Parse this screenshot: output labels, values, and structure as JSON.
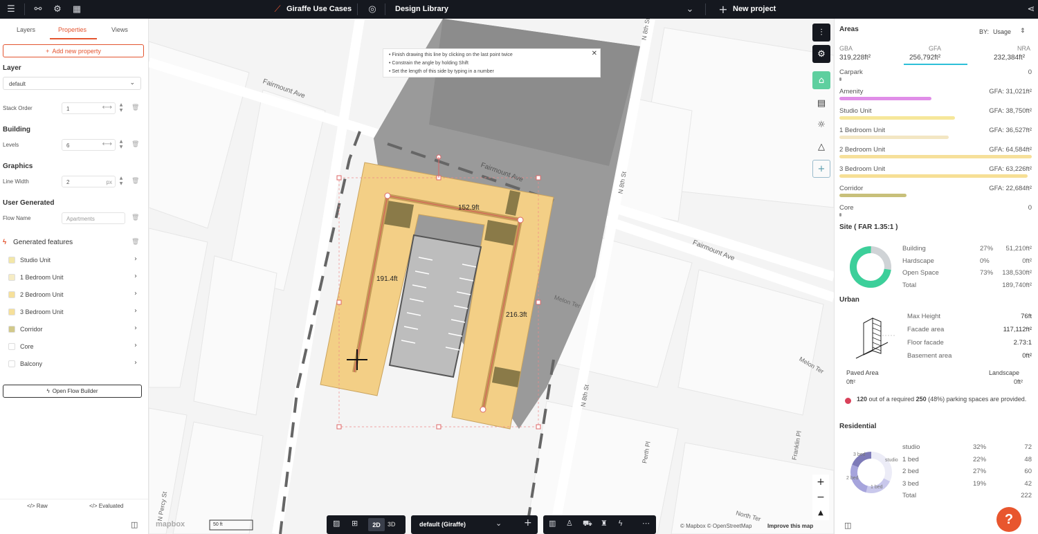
{
  "topbar": {
    "project_name": "Giraffe Use Cases",
    "library": "Design Library",
    "new_project": "New project"
  },
  "left_panel": {
    "tabs": [
      "Layers",
      "Properties",
      "Views"
    ],
    "add_property": "Add new property",
    "layer_heading": "Layer",
    "layer_value": "default",
    "stack_order_label": "Stack Order",
    "stack_order_value": "1",
    "building_heading": "Building",
    "levels_label": "Levels",
    "levels_value": "6",
    "graphics_heading": "Graphics",
    "line_width_label": "Line Width",
    "line_width_value": "2",
    "line_width_unit": "px",
    "user_generated_heading": "User Generated",
    "flow_name_label": "Flow Name",
    "flow_name_placeholder": "Apartments",
    "generated_heading": "Generated features",
    "features": [
      {
        "label": "Studio Unit",
        "color": "#f3e7a8"
      },
      {
        "label": "1 Bedroom Unit",
        "color": "#f6ecc4"
      },
      {
        "label": "2 Bedroom Unit",
        "color": "#f6e09a"
      },
      {
        "label": "3 Bedroom Unit",
        "color": "#f6e09a"
      },
      {
        "label": "Corridor",
        "color": "#d2c98a"
      },
      {
        "label": "Core",
        "color": "#ffffff"
      },
      {
        "label": "Balcony",
        "color": "#ffffff"
      }
    ],
    "open_flow_builder": "Open Flow Builder",
    "raw": "Raw",
    "evaluated": "Evaluated"
  },
  "map": {
    "hints": [
      "Finish drawing this line by clicking on the last point twice",
      "Constrain the angle by holding Shift",
      "Set the length of this side by typing in a number"
    ],
    "streets": [
      "Fairmount Ave",
      "Fairmount Ave",
      "Fairmount Ave",
      "N 8th St",
      "N 8th St",
      "N 8th St",
      "Melon Ter",
      "Melon Ter",
      "Perth Pl",
      "Franklin Pl",
      "North Ter",
      "N Percy St"
    ],
    "dimensions": [
      "152.9ft",
      "191.4ft",
      "216.3ft"
    ],
    "scale": "50 ft",
    "attribution": "© Mapbox © OpenStreetMap",
    "improve": "Improve this map",
    "mapbox_logo": "mapbox",
    "mode_2d": "2D",
    "mode_3d": "3D",
    "style_select": "default (Giraffe)"
  },
  "right_panel": {
    "areas_heading": "Areas",
    "by_label": "BY:",
    "by_value": "Usage",
    "gba_label": "GBA",
    "gba_value": "319,228ft²",
    "gfa_label": "GFA",
    "gfa_value": "256,792ft²",
    "nra_label": "NRA",
    "nra_value": "232,384ft²",
    "usages": [
      {
        "name": "Carpark",
        "value": "0",
        "color": "#999999",
        "fraction": 0.01
      },
      {
        "name": "Amenity",
        "value": "GFA: 31,021ft²",
        "color": "#e08ee8",
        "fraction": 0.48
      },
      {
        "name": "Studio Unit",
        "value": "GFA: 38,750ft²",
        "color": "#f6e79a",
        "fraction": 0.6
      },
      {
        "name": "1 Bedroom Unit",
        "value": "GFA: 36,527ft²",
        "color": "#f3e6c3",
        "fraction": 0.57
      },
      {
        "name": "2 Bedroom Unit",
        "value": "GFA: 64,584ft²",
        "color": "#f6e09a",
        "fraction": 1.0
      },
      {
        "name": "3 Bedroom Unit",
        "value": "GFA: 63,226ft²",
        "color": "#f6df95",
        "fraction": 0.98
      },
      {
        "name": "Corridor",
        "value": "GFA: 22,684ft²",
        "color": "#c8c07a",
        "fraction": 0.35
      },
      {
        "name": "Core",
        "value": "0",
        "color": "#999999",
        "fraction": 0.01
      }
    ],
    "site_heading": "Site ( FAR 1.35:1 )",
    "site_rows": [
      {
        "label": "Building",
        "pct": "27%",
        "value": "51,210ft²"
      },
      {
        "label": "Hardscape",
        "pct": "0%",
        "value": "0ft²"
      },
      {
        "label": "Open Space",
        "pct": "73%",
        "value": "138,530ft²"
      },
      {
        "label": "Total",
        "pct": "",
        "value": "189,740ft²"
      }
    ],
    "site_donut": {
      "building": 0.27,
      "open_space": 0.73,
      "building_color": "#cfd3d6",
      "open_color": "#3ccf9a"
    },
    "urban_heading": "Urban",
    "urban_rows": [
      {
        "label": "Max Height",
        "value": "76ft"
      },
      {
        "label": "Facade area",
        "value": "117,112ft²"
      },
      {
        "label": "Floor facade",
        "value": "2.73:1"
      },
      {
        "label": "Basement area",
        "value": "0ft²"
      }
    ],
    "paved_label": "Paved Area",
    "paved_value": "0ft²",
    "landscape_label": "Landscape",
    "landscape_value": "0ft²",
    "parking_count": "120",
    "parking_text_a": "out of a required",
    "parking_required": "250",
    "parking_text_b": "(48%) parking spaces are provided.",
    "residential_heading": "Residential",
    "residential_rows": [
      {
        "label": "studio",
        "pct": "32%",
        "value": "72"
      },
      {
        "label": "1 bed",
        "pct": "22%",
        "value": "48"
      },
      {
        "label": "2 bed",
        "pct": "27%",
        "value": "60"
      },
      {
        "label": "3 bed",
        "pct": "19%",
        "value": "42"
      },
      {
        "label": "Total",
        "pct": "",
        "value": "222"
      }
    ],
    "res_donut_labels": [
      "3 bed",
      "studio",
      "2 bed",
      "1 bed"
    ],
    "res_donut": [
      0.32,
      0.22,
      0.27,
      0.19
    ]
  },
  "help": "?"
}
